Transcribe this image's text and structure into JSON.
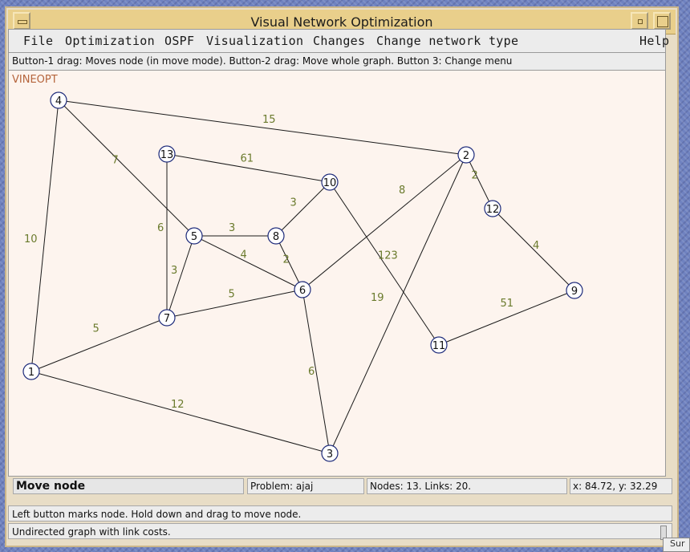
{
  "window": {
    "title": "Visual Network Optimization"
  },
  "menu": [
    {
      "label": "File",
      "right": false
    },
    {
      "label": "Optimization",
      "right": false
    },
    {
      "label": "OSPF",
      "right": false
    },
    {
      "label": "Visualization",
      "right": false
    },
    {
      "label": "Changes",
      "right": false
    },
    {
      "label": "Change network type",
      "right": false
    },
    {
      "label": "Help",
      "right": true
    }
  ],
  "hint": "Button-1 drag: Moves node (in move mode). Button-2 drag: Move whole graph. Button 3: Change menu",
  "graph": {
    "brand_label": "VINEOPT",
    "colors": {
      "brand": "#b5653c",
      "node_stroke": "#1d2a7a",
      "edge": "#1a1a1a",
      "cost": "#6a7a2c"
    },
    "nodes": [
      {
        "id": "1"
      },
      {
        "id": "2"
      },
      {
        "id": "3"
      },
      {
        "id": "4"
      },
      {
        "id": "5"
      },
      {
        "id": "6"
      },
      {
        "id": "7"
      },
      {
        "id": "8"
      },
      {
        "id": "9"
      },
      {
        "id": "10"
      },
      {
        "id": "11"
      },
      {
        "id": "12"
      },
      {
        "id": "13"
      }
    ],
    "edges": [
      {
        "from": "4",
        "to": "2",
        "cost": "15"
      },
      {
        "from": "4",
        "to": "1",
        "cost": "10"
      },
      {
        "from": "4",
        "to": "5",
        "cost": "7"
      },
      {
        "from": "13",
        "to": "10",
        "cost": "61"
      },
      {
        "from": "13",
        "to": "7",
        "cost": "6"
      },
      {
        "from": "10",
        "to": "8",
        "cost": "3"
      },
      {
        "from": "10",
        "to": "11",
        "cost": "123"
      },
      {
        "from": "2",
        "to": "12",
        "cost": "2"
      },
      {
        "from": "2",
        "to": "6",
        "cost": "8"
      },
      {
        "from": "2",
        "to": "3",
        "cost": "19"
      },
      {
        "from": "12",
        "to": "9",
        "cost": "4"
      },
      {
        "from": "5",
        "to": "8",
        "cost": "3"
      },
      {
        "from": "5",
        "to": "6",
        "cost": "4"
      },
      {
        "from": "5",
        "to": "7",
        "cost": "3"
      },
      {
        "from": "8",
        "to": "6",
        "cost": "2"
      },
      {
        "from": "7",
        "to": "6",
        "cost": "5"
      },
      {
        "from": "1",
        "to": "7",
        "cost": "5"
      },
      {
        "from": "1",
        "to": "3",
        "cost": "12"
      },
      {
        "from": "6",
        "to": "3",
        "cost": "6"
      },
      {
        "from": "9",
        "to": "11",
        "cost": "51"
      }
    ]
  },
  "status": {
    "mode": "Move node",
    "problem": "Problem: ajaj",
    "counts": "Nodes: 13. Links: 20.",
    "coords": "x: 84.72, y: 32.29"
  },
  "messages": {
    "help": "Left button marks node. Hold down and drag to move node.",
    "graph_type": "Undirected graph with link costs."
  },
  "corner": "Sur"
}
